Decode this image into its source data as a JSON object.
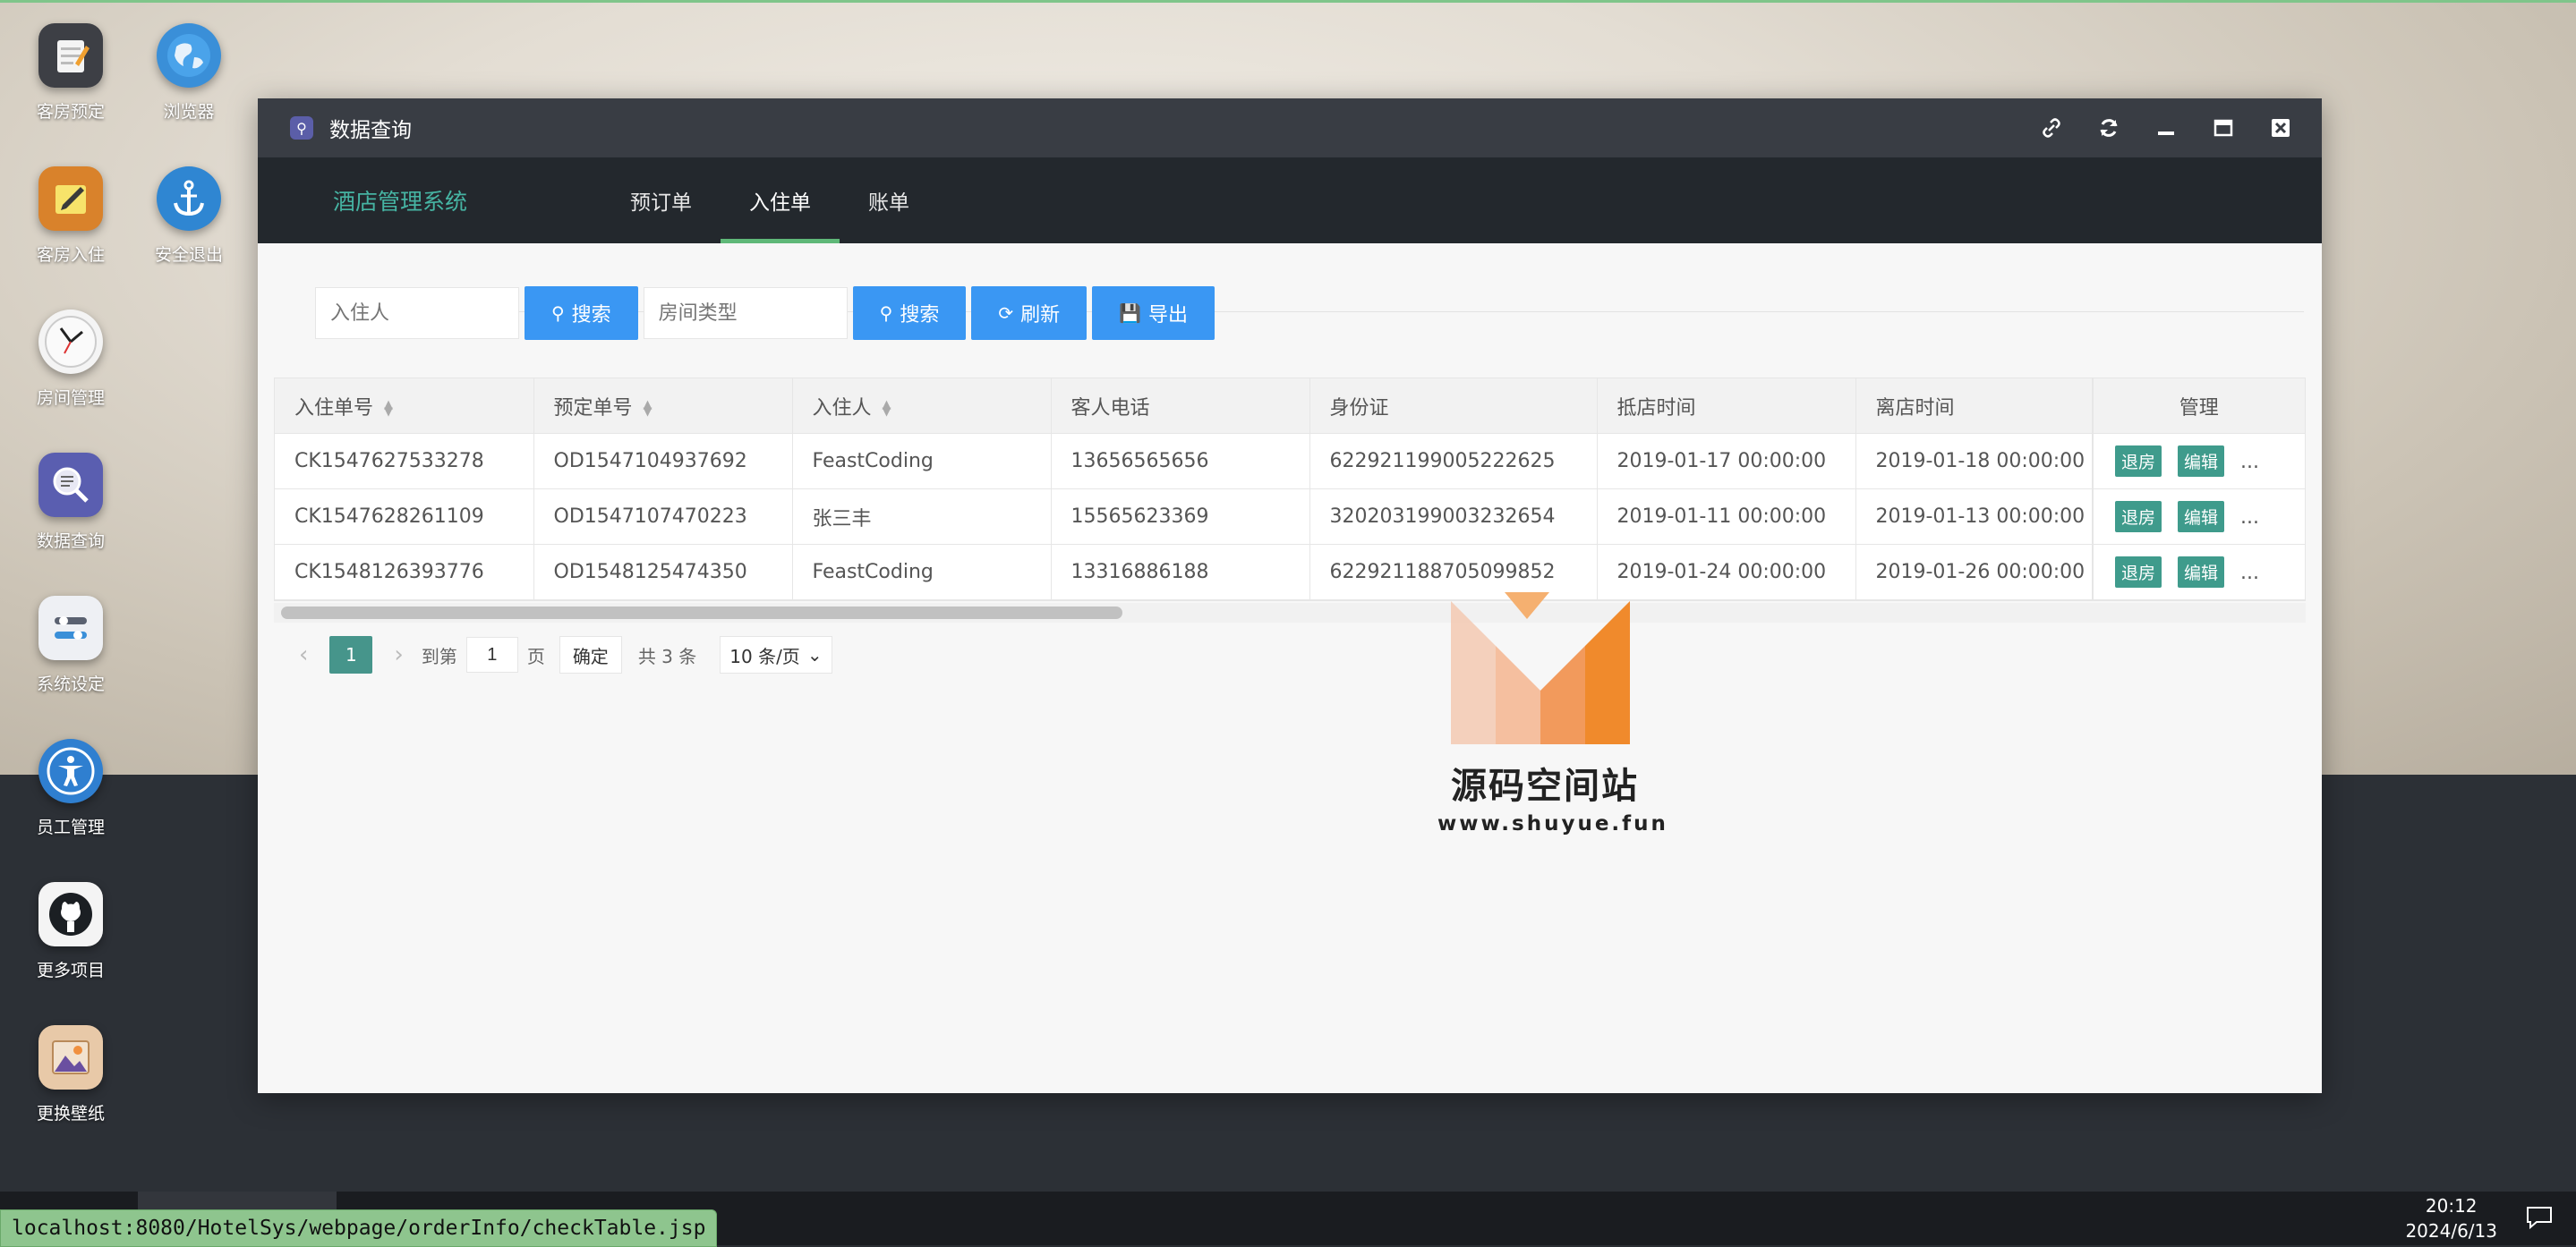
{
  "desktop": {
    "icons": [
      {
        "label": "客房预定",
        "icon": "notepad-icon"
      },
      {
        "label": "浏览器",
        "icon": "globe-icon"
      },
      {
        "label": "客房入住",
        "icon": "pencil-note-icon"
      },
      {
        "label": "安全退出",
        "icon": "anchor-icon"
      },
      {
        "label": "房间管理",
        "icon": "clock-icon"
      },
      {
        "label": "数据查询",
        "icon": "search-data-icon"
      },
      {
        "label": "系统设定",
        "icon": "toggle-settings-icon"
      },
      {
        "label": "员工管理",
        "icon": "accessibility-icon"
      },
      {
        "label": "更多项目",
        "icon": "github-icon"
      },
      {
        "label": "更换壁纸",
        "icon": "picture-icon"
      }
    ]
  },
  "window": {
    "title": "数据查询",
    "controls": [
      "link-icon",
      "refresh-icon",
      "minimize-icon",
      "maximize-icon",
      "close-icon"
    ]
  },
  "nav": {
    "brand": "酒店管理系统",
    "tabs": [
      {
        "label": "预订单",
        "active": false
      },
      {
        "label": "入住单",
        "active": true
      },
      {
        "label": "账单",
        "active": false
      }
    ]
  },
  "toolbar": {
    "guest_placeholder": "入住人",
    "search1_label": "搜索",
    "roomtype_placeholder": "房间类型",
    "search2_label": "搜索",
    "refresh_label": "刷新",
    "export_label": "导出"
  },
  "table": {
    "columns": [
      "入住单号",
      "预定单号",
      "入住人",
      "客人电话",
      "身份证",
      "抵店时间",
      "离店时间",
      "管理"
    ],
    "rows": [
      [
        "CK1547627533278",
        "OD1547104937692",
        "FeastCoding",
        "13656565656",
        "622921199005222625",
        "2019-01-17 00:00:00",
        "2019-01-18 00:00:00"
      ],
      [
        "CK1547628261109",
        "OD1547107470223",
        "张三丰",
        "15565623369",
        "320203199003232654",
        "2019-01-11 00:00:00",
        "2019-01-13 00:00:00"
      ],
      [
        "CK1548126393776",
        "OD1548125474350",
        "FeastCoding",
        "13316886188",
        "622921188705099852",
        "2019-01-24 00:00:00",
        "2019-01-26 00:00:00"
      ]
    ],
    "actions": {
      "checkout": "退房",
      "edit": "编辑",
      "more": "..."
    }
  },
  "pager": {
    "current": "1",
    "goto_label": "到第",
    "page_input": "1",
    "page_unit": "页",
    "confirm": "确定",
    "total": "共 3 条",
    "per_page": "10 条/页"
  },
  "watermark": {
    "title": "源码空间站",
    "url": "www.shuyue.fun"
  },
  "taskbar": {
    "time": "20:12",
    "date": "2024/6/13"
  },
  "status_url": "localhost:8080/HotelSys/webpage/orderInfo/checkTable.jsp"
}
